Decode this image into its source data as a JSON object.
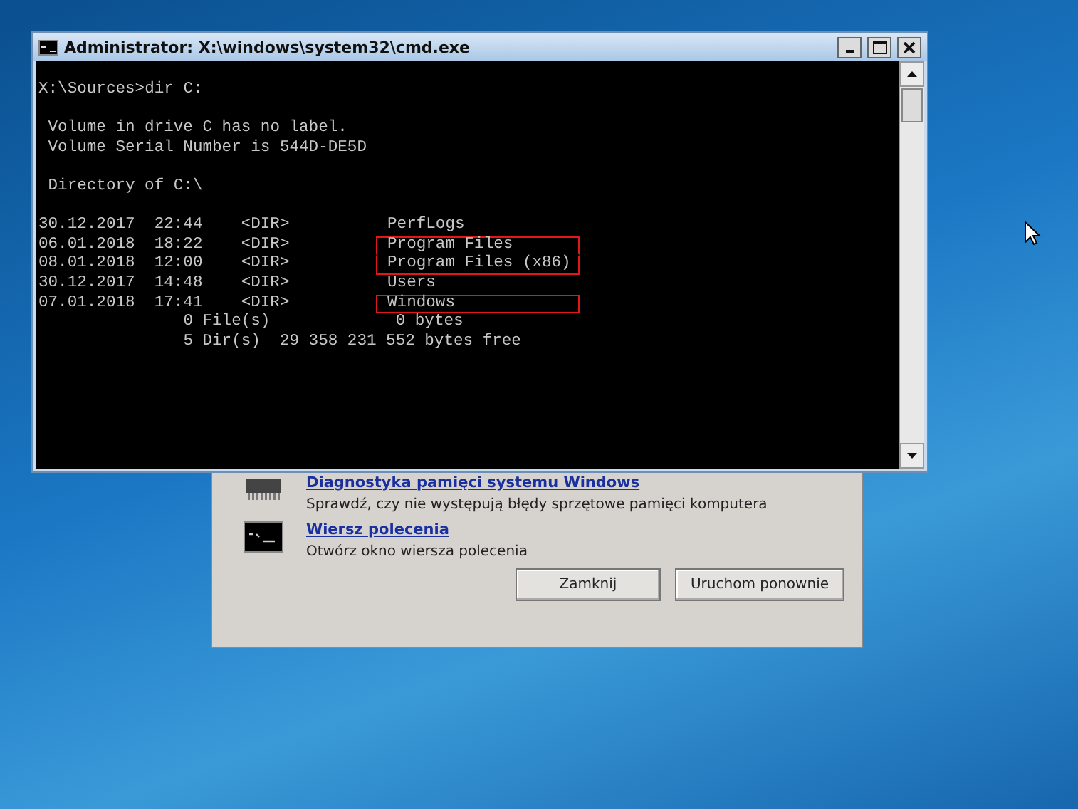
{
  "dialog": {
    "tools": [
      {
        "kind": "memory",
        "link": "Diagnostyka pamięci systemu Windows",
        "description": "Sprawdź, czy nie występują błędy sprzętowe pamięci komputera"
      },
      {
        "kind": "console",
        "link": "Wiersz polecenia",
        "description": "Otwórz okno wiersza polecenia"
      }
    ],
    "buttons": [
      "Zamknij",
      "Uruchom ponownie"
    ]
  },
  "console_window": {
    "title": "Administrator: X:\\windows\\system32\\cmd.exe",
    "prompt": "X:\\Sources>dir C:",
    "header": [
      "Volume in drive C has no label.",
      "Volume Serial Number is 544D-DE5D"
    ],
    "directory": "Directory of C:\\",
    "rows": [
      {
        "date": "30.12.2017",
        "time": "22:44",
        "type": "<DIR>",
        "name": "PerfLogs",
        "highlighted": false
      },
      {
        "date": "06.01.2018",
        "time": "18:22",
        "type": "<DIR>",
        "name": "Program Files",
        "highlighted": true
      },
      {
        "date": "08.01.2018",
        "time": "12:00",
        "type": "<DIR>",
        "name": "Program Files (x86)",
        "highlighted": true
      },
      {
        "date": "30.12.2017",
        "time": "14:48",
        "type": "<DIR>",
        "name": "Users",
        "highlighted": false
      },
      {
        "date": "07.01.2018",
        "time": "17:41",
        "type": "<DIR>",
        "name": "Windows",
        "highlighted": true
      }
    ],
    "summary": [
      {
        "count": "0 File(s)",
        "size": "0 bytes"
      },
      {
        "count": "5 Dir(s)",
        "size": "29 358 231 552 bytes free"
      }
    ]
  }
}
